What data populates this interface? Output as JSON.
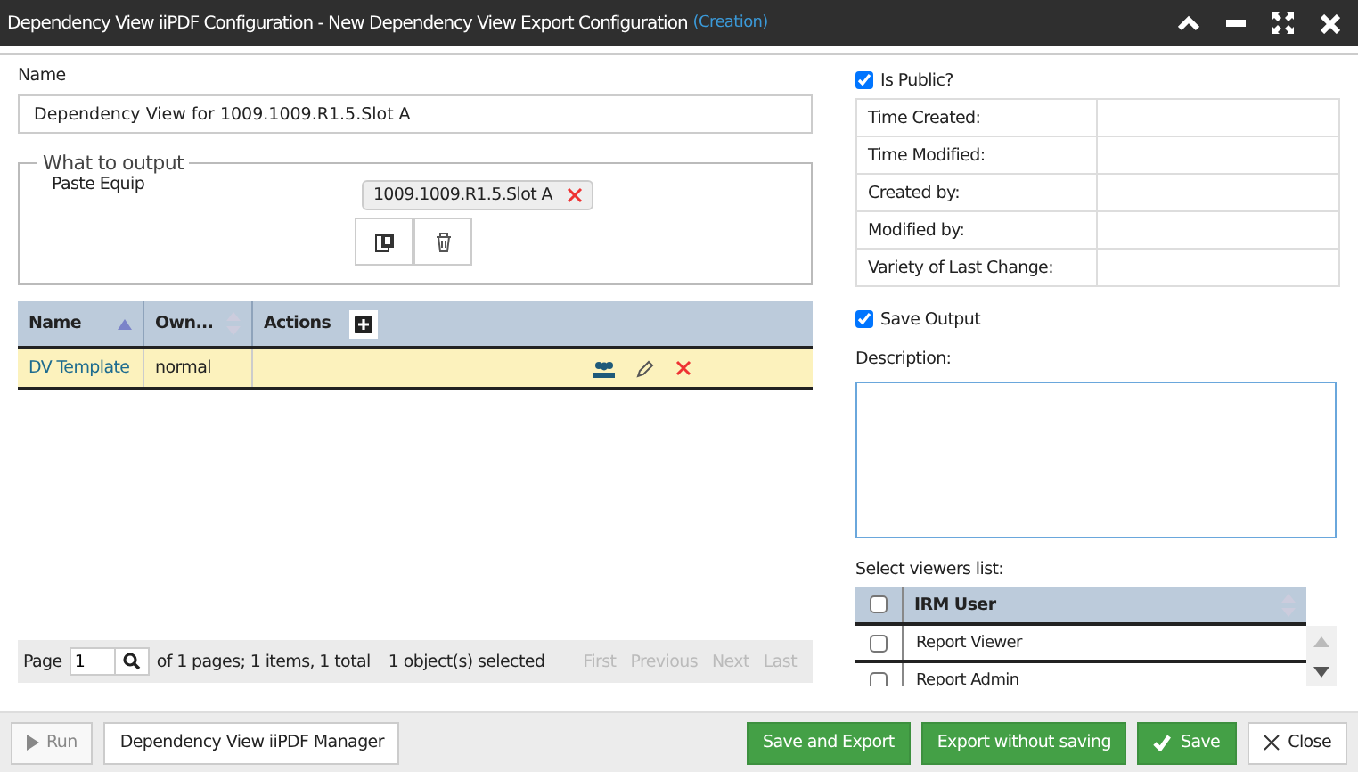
{
  "window": {
    "title": "Dependency View iiPDF Configuration - New Dependency View Export Configuration",
    "mode": "(Creation)"
  },
  "name_field": {
    "label": "Name",
    "value": "Dependency View for 1009.1009.R1.5.Slot A"
  },
  "output_group": {
    "legend": "What to output",
    "label": "Paste Equip",
    "tag": "1009.1009.R1.5.Slot A"
  },
  "table": {
    "columns": [
      {
        "label": "Name",
        "kind": "sorted"
      },
      {
        "label": "Own...",
        "kind": "sortable"
      },
      {
        "label": "Actions",
        "kind": "actions"
      }
    ],
    "rows": [
      {
        "name": "DV Template",
        "owner": "normal",
        "selected": true
      }
    ]
  },
  "pager": {
    "label": "Page",
    "page": "1",
    "summary": "of 1 pages; 1 items, 1 total",
    "selection": "1 object(s) selected",
    "links": [
      "First",
      "Previous",
      "Next",
      "Last"
    ]
  },
  "is_public": {
    "label": "Is Public?",
    "checked": true
  },
  "info": [
    "Time Created:",
    "Time Modified:",
    "Created by:",
    "Modified by:",
    "Variety of Last Change:"
  ],
  "save_output": {
    "label": "Save Output",
    "checked": true
  },
  "description": {
    "label": "Description:"
  },
  "viewers": {
    "label": "Select viewers list:",
    "column": "IRM User",
    "all_checked": false,
    "rows": [
      {
        "name": "Report Viewer",
        "checked": false
      },
      {
        "name": "Report Admin",
        "checked": false
      }
    ]
  },
  "footer": {
    "left": [
      {
        "label": "Run",
        "kind": "run",
        "disabled": true
      },
      {
        "label": "Dependency View iiPDF Manager",
        "kind": "plain",
        "disabled": false
      }
    ],
    "right": [
      {
        "label": "Save and Export",
        "kind": "green"
      },
      {
        "label": "Export without saving",
        "kind": "green"
      },
      {
        "label": "Save",
        "kind": "save"
      },
      {
        "label": "Close",
        "kind": "close"
      }
    ]
  }
}
